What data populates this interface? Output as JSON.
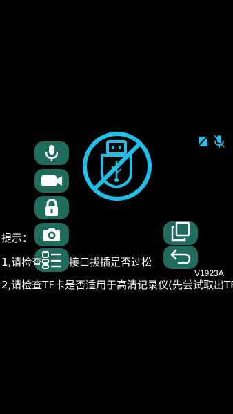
{
  "hints": {
    "title": "提示：",
    "line1_prefix": "1,请检查",
    "line1_suffix": "接口拔插是否过松",
    "line2": "2,请检查TF卡是否适用于高清记录仪(先尝试取出TF"
  },
  "version": "V1923A",
  "icons": {
    "left_column": [
      "microphone-icon",
      "video-camera-icon",
      "lock-icon",
      "camera-icon",
      "menu-list-icon"
    ],
    "right_column": [
      "copy-icon",
      "back-icon"
    ],
    "center": "usb-disconnected-icon",
    "status": [
      "sd-card-error-icon",
      "microphone-muted-icon"
    ]
  },
  "colors": {
    "accent": "#1ec0e8",
    "button_bg": "#1f6b5c",
    "background": "#000000",
    "text": "#ffffff"
  }
}
